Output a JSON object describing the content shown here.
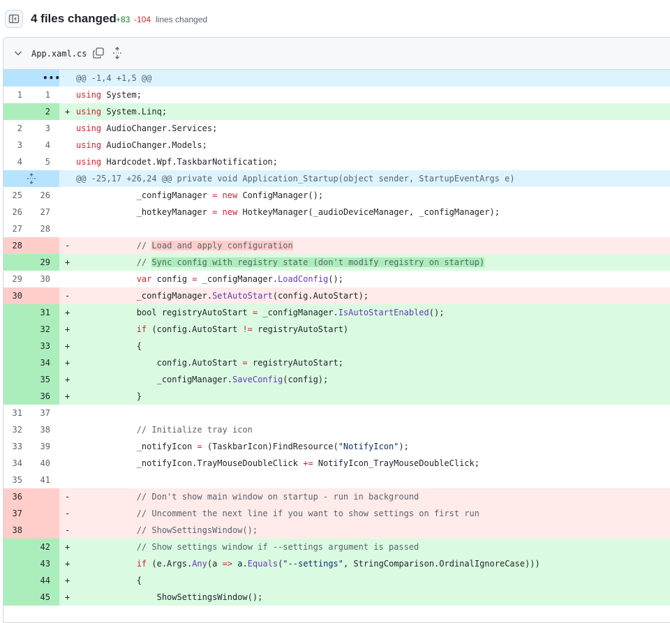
{
  "summary": {
    "title": "4 files changed",
    "additions": "+83",
    "deletions": "-104",
    "label": "lines changed"
  },
  "file": {
    "name": "App.xaml.cs"
  },
  "colors": {
    "addition": "#1a7f37",
    "deletion": "#d1242f",
    "add_bg": "#dafbe1",
    "del_bg": "#ffebe9",
    "hunk_bg": "#ddf4ff"
  },
  "icons": {
    "sidebar_toggle": "sidebar-toggle-icon",
    "chevron": "chevron-down-icon",
    "copy": "copy-icon",
    "expand": "unfold-icon",
    "hunk_dots": "kebab-horizontal-icon"
  },
  "diff": [
    {
      "type": "hunk",
      "old": "",
      "new": "",
      "marker": "",
      "expand": "dots",
      "code": [
        {
          "t": "@@ -1,4 +1,5 @@"
        }
      ]
    },
    {
      "type": "ctx",
      "old": "1",
      "new": "1",
      "marker": "",
      "code": [
        {
          "t": "using",
          "c": "kw"
        },
        {
          "t": " System;"
        }
      ]
    },
    {
      "type": "add",
      "old": "",
      "new": "2",
      "marker": "+",
      "code": [
        {
          "t": "using",
          "c": "kw"
        },
        {
          "t": " System.Linq;"
        }
      ]
    },
    {
      "type": "ctx",
      "old": "2",
      "new": "3",
      "marker": "",
      "code": [
        {
          "t": "using",
          "c": "kw"
        },
        {
          "t": " AudioChanger.Services;"
        }
      ]
    },
    {
      "type": "ctx",
      "old": "3",
      "new": "4",
      "marker": "",
      "code": [
        {
          "t": "using",
          "c": "kw"
        },
        {
          "t": " AudioChanger.Models;"
        }
      ]
    },
    {
      "type": "ctx",
      "old": "4",
      "new": "5",
      "marker": "",
      "code": [
        {
          "t": "using",
          "c": "kw"
        },
        {
          "t": " Hardcodet.Wpf.TaskbarNotification;"
        }
      ]
    },
    {
      "type": "hunk",
      "old": "",
      "new": "",
      "marker": "",
      "expand": "arrows",
      "code": [
        {
          "t": "@@ -25,17 +26,24 @@ private void Application_Startup(object sender, StartupEventArgs e)"
        }
      ]
    },
    {
      "type": "ctx",
      "old": "25",
      "new": "26",
      "marker": "",
      "code": [
        {
          "t": "            _configManager "
        },
        {
          "t": "=",
          "c": "kw"
        },
        {
          "t": " "
        },
        {
          "t": "new",
          "c": "kw"
        },
        {
          "t": " ConfigManager();"
        }
      ]
    },
    {
      "type": "ctx",
      "old": "26",
      "new": "27",
      "marker": "",
      "code": [
        {
          "t": "            _hotkeyManager "
        },
        {
          "t": "=",
          "c": "kw"
        },
        {
          "t": " "
        },
        {
          "t": "new",
          "c": "kw"
        },
        {
          "t": " HotkeyManager(_audioDeviceManager, _configManager);"
        }
      ]
    },
    {
      "type": "ctx",
      "old": "27",
      "new": "28",
      "marker": "",
      "code": [
        {
          "t": ""
        }
      ]
    },
    {
      "type": "del",
      "old": "28",
      "new": "",
      "marker": "-",
      "code": [
        {
          "t": "            "
        },
        {
          "t": "// ",
          "c": "cm"
        },
        {
          "t": "Load and apply configuration",
          "c": "cm hl-del"
        }
      ]
    },
    {
      "type": "add",
      "old": "",
      "new": "29",
      "marker": "+",
      "code": [
        {
          "t": "            "
        },
        {
          "t": "// ",
          "c": "cm"
        },
        {
          "t": "Sync config with registry state (don't modify registry on startup)",
          "c": "cm hl-add"
        }
      ]
    },
    {
      "type": "ctx",
      "old": "29",
      "new": "30",
      "marker": "",
      "code": [
        {
          "t": "            "
        },
        {
          "t": "var",
          "c": "kw"
        },
        {
          "t": " config "
        },
        {
          "t": "=",
          "c": "kw"
        },
        {
          "t": " _configManager."
        },
        {
          "t": "LoadConfig",
          "c": "fn"
        },
        {
          "t": "();"
        }
      ]
    },
    {
      "type": "del",
      "old": "30",
      "new": "",
      "marker": "-",
      "code": [
        {
          "t": "            _configManager."
        },
        {
          "t": "SetAutoStart",
          "c": "fn"
        },
        {
          "t": "(config.AutoStart);"
        }
      ]
    },
    {
      "type": "add",
      "old": "",
      "new": "31",
      "marker": "+",
      "code": [
        {
          "t": "            bool registryAutoStart "
        },
        {
          "t": "=",
          "c": "kw"
        },
        {
          "t": " _configManager."
        },
        {
          "t": "IsAutoStartEnabled",
          "c": "fn"
        },
        {
          "t": "();"
        }
      ]
    },
    {
      "type": "add",
      "old": "",
      "new": "32",
      "marker": "+",
      "code": [
        {
          "t": "            "
        },
        {
          "t": "if",
          "c": "kw"
        },
        {
          "t": " (config.AutoStart "
        },
        {
          "t": "!=",
          "c": "kw"
        },
        {
          "t": " registryAutoStart)"
        }
      ]
    },
    {
      "type": "add",
      "old": "",
      "new": "33",
      "marker": "+",
      "code": [
        {
          "t": "            {"
        }
      ]
    },
    {
      "type": "add",
      "old": "",
      "new": "34",
      "marker": "+",
      "code": [
        {
          "t": "                config.AutoStart "
        },
        {
          "t": "=",
          "c": "kw"
        },
        {
          "t": " registryAutoStart;"
        }
      ]
    },
    {
      "type": "add",
      "old": "",
      "new": "35",
      "marker": "+",
      "code": [
        {
          "t": "                _configManager."
        },
        {
          "t": "SaveConfig",
          "c": "fn"
        },
        {
          "t": "(config);"
        }
      ]
    },
    {
      "type": "add",
      "old": "",
      "new": "36",
      "marker": "+",
      "code": [
        {
          "t": "            }"
        }
      ]
    },
    {
      "type": "ctx",
      "old": "31",
      "new": "37",
      "marker": "",
      "code": [
        {
          "t": ""
        }
      ]
    },
    {
      "type": "ctx",
      "old": "32",
      "new": "38",
      "marker": "",
      "code": [
        {
          "t": "            "
        },
        {
          "t": "// Initialize tray icon",
          "c": "cm"
        }
      ]
    },
    {
      "type": "ctx",
      "old": "33",
      "new": "39",
      "marker": "",
      "code": [
        {
          "t": "            _notifyIcon "
        },
        {
          "t": "=",
          "c": "kw"
        },
        {
          "t": " (TaskbarIcon)FindResource("
        },
        {
          "t": "\"NotifyIcon\"",
          "c": "st"
        },
        {
          "t": ");"
        }
      ]
    },
    {
      "type": "ctx",
      "old": "34",
      "new": "40",
      "marker": "",
      "code": [
        {
          "t": "            _notifyIcon.TrayMouseDoubleClick "
        },
        {
          "t": "+=",
          "c": "kw"
        },
        {
          "t": " NotifyIcon_TrayMouseDoubleClick;"
        }
      ]
    },
    {
      "type": "ctx",
      "old": "35",
      "new": "41",
      "marker": "",
      "code": [
        {
          "t": ""
        }
      ]
    },
    {
      "type": "del",
      "old": "36",
      "new": "",
      "marker": "-",
      "code": [
        {
          "t": "            "
        },
        {
          "t": "// Don't show main window on startup - run in background",
          "c": "cm"
        }
      ]
    },
    {
      "type": "del",
      "old": "37",
      "new": "",
      "marker": "-",
      "code": [
        {
          "t": "            "
        },
        {
          "t": "// Uncomment the next line if you want to show settings on first run",
          "c": "cm"
        }
      ]
    },
    {
      "type": "del",
      "old": "38",
      "new": "",
      "marker": "-",
      "code": [
        {
          "t": "            "
        },
        {
          "t": "// ShowSettingsWindow();",
          "c": "cm"
        }
      ]
    },
    {
      "type": "add",
      "old": "",
      "new": "42",
      "marker": "+",
      "code": [
        {
          "t": "            "
        },
        {
          "t": "// Show settings window if --settings argument is passed",
          "c": "cm"
        }
      ]
    },
    {
      "type": "add",
      "old": "",
      "new": "43",
      "marker": "+",
      "code": [
        {
          "t": "            "
        },
        {
          "t": "if",
          "c": "kw"
        },
        {
          "t": " (e.Args."
        },
        {
          "t": "Any",
          "c": "fn"
        },
        {
          "t": "(a "
        },
        {
          "t": "=>",
          "c": "kw"
        },
        {
          "t": " a."
        },
        {
          "t": "Equals",
          "c": "fn"
        },
        {
          "t": "("
        },
        {
          "t": "\"--settings\"",
          "c": "st"
        },
        {
          "t": ", StringComparison.OrdinalIgnoreCase)))"
        }
      ]
    },
    {
      "type": "add",
      "old": "",
      "new": "44",
      "marker": "+",
      "code": [
        {
          "t": "            {"
        }
      ]
    },
    {
      "type": "add",
      "old": "",
      "new": "45",
      "marker": "+",
      "code": [
        {
          "t": "                ShowSettingsWindow();"
        }
      ]
    }
  ]
}
